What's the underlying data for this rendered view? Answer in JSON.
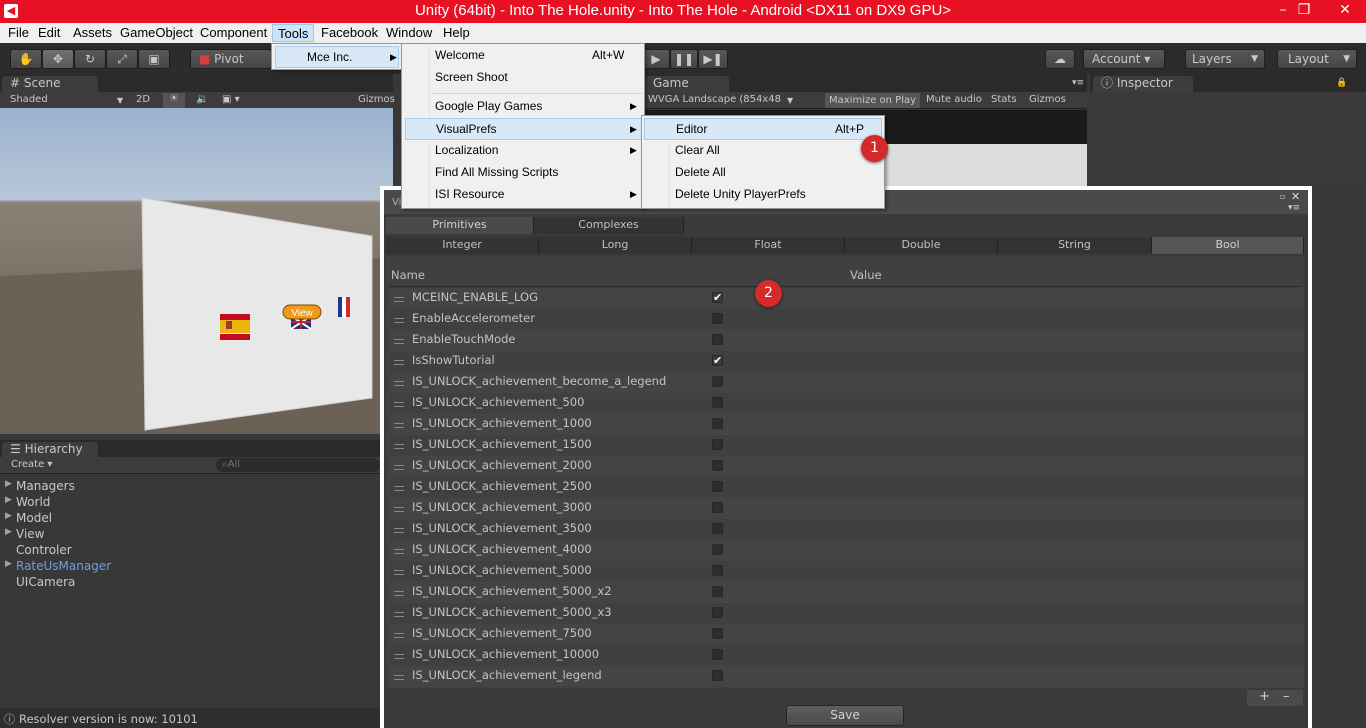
{
  "window": {
    "title": "Unity (64bit) - Into The Hole.unity - Into The Hole - Android <DX11 on DX9 GPU>",
    "minimize": "–",
    "maximize": "❐",
    "close": "✕"
  },
  "menubar": {
    "items": [
      "File",
      "Edit",
      "Assets",
      "GameObject",
      "Component",
      "Tools",
      "Facebook",
      "Window",
      "Help"
    ]
  },
  "toolbar": {
    "pivot": "Pivot",
    "account": "Account ▾",
    "layers": "Layers",
    "layout": "Layout"
  },
  "scene": {
    "tab": "Scene",
    "shaded": "Shaded",
    "mode2d": "2D",
    "gizmos": "Gizmos",
    "view_label": "View"
  },
  "game": {
    "tab": "Game",
    "aspect": "WVGA Landscape (854x48",
    "maximize_on_play": "Maximize on Play",
    "mute_audio": "Mute audio",
    "stats": "Stats",
    "gizmos": "Gizmos"
  },
  "inspector": {
    "tab": "Inspector"
  },
  "hierarchy": {
    "tab": "Hierarchy",
    "create": "Create",
    "search_placeholder": "All",
    "items": [
      {
        "label": "Managers",
        "expandable": true,
        "highlight": false
      },
      {
        "label": "World",
        "expandable": true,
        "highlight": false
      },
      {
        "label": "Model",
        "expandable": true,
        "highlight": false
      },
      {
        "label": "View",
        "expandable": true,
        "highlight": false
      },
      {
        "label": "Controler",
        "expandable": false,
        "highlight": false
      },
      {
        "label": "RateUsManager",
        "expandable": true,
        "highlight": true
      },
      {
        "label": "UICamera",
        "expandable": false,
        "highlight": false
      }
    ]
  },
  "status": {
    "text": "Resolver version is now: 10101"
  },
  "menus": {
    "tools_items": [
      {
        "label": "Mce Inc.",
        "submenu": true
      }
    ],
    "mce_items": [
      {
        "label": "Welcome",
        "shortcut": "Alt+W",
        "submenu": false
      },
      {
        "label": "Screen Shoot",
        "shortcut": "",
        "submenu": false
      },
      {
        "label": "Google Play Games",
        "shortcut": "",
        "submenu": true
      },
      {
        "label": "VisualPrefs",
        "shortcut": "",
        "submenu": true
      },
      {
        "label": "Localization",
        "shortcut": "",
        "submenu": true
      },
      {
        "label": "Find All Missing Scripts",
        "shortcut": "",
        "submenu": false
      },
      {
        "label": "ISI Resource",
        "shortcut": "",
        "submenu": true
      }
    ],
    "visualprefs_items": [
      {
        "label": "Editor",
        "shortcut": "Alt+P"
      },
      {
        "label": "Clear All",
        "shortcut": ""
      },
      {
        "label": "Delete All",
        "shortcut": ""
      },
      {
        "label": "Delete Unity PlayerPrefs",
        "shortcut": ""
      }
    ]
  },
  "visualprefs": {
    "title": "Vi",
    "group_tabs": [
      "Primitives",
      "Complexes"
    ],
    "type_tabs": [
      "Integer",
      "Long",
      "Float",
      "Double",
      "String",
      "Bool"
    ],
    "selected_type": "Bool",
    "col_name": "Name",
    "col_value": "Value",
    "rows": [
      {
        "name": "MCEINC_ENABLE_LOG",
        "checked": true
      },
      {
        "name": "EnableAccelerometer",
        "checked": false
      },
      {
        "name": "EnableTouchMode",
        "checked": false
      },
      {
        "name": "IsShowTutorial",
        "checked": true
      },
      {
        "name": "IS_UNLOCK_achievement_become_a_legend",
        "checked": false
      },
      {
        "name": "IS_UNLOCK_achievement_500",
        "checked": false
      },
      {
        "name": "IS_UNLOCK_achievement_1000",
        "checked": false
      },
      {
        "name": "IS_UNLOCK_achievement_1500",
        "checked": false
      },
      {
        "name": "IS_UNLOCK_achievement_2000",
        "checked": false
      },
      {
        "name": "IS_UNLOCK_achievement_2500",
        "checked": false
      },
      {
        "name": "IS_UNLOCK_achievement_3000",
        "checked": false
      },
      {
        "name": "IS_UNLOCK_achievement_3500",
        "checked": false
      },
      {
        "name": "IS_UNLOCK_achievement_4000",
        "checked": false
      },
      {
        "name": "IS_UNLOCK_achievement_5000",
        "checked": false
      },
      {
        "name": "IS_UNLOCK_achievement_5000_x2",
        "checked": false
      },
      {
        "name": "IS_UNLOCK_achievement_5000_x3",
        "checked": false
      },
      {
        "name": "IS_UNLOCK_achievement_7500",
        "checked": false
      },
      {
        "name": "IS_UNLOCK_achievement_10000",
        "checked": false
      },
      {
        "name": "IS_UNLOCK_achievement_legend",
        "checked": false
      }
    ],
    "add": "+",
    "remove": "–",
    "save": "Save"
  },
  "callouts": [
    "1",
    "2"
  ],
  "colors": {
    "titlebar": "#e81123",
    "callout": "#d42a2a",
    "highlight_item": "#6f9ee0"
  }
}
